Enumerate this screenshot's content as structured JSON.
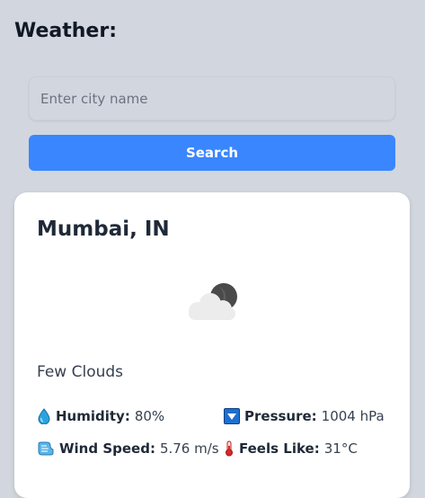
{
  "header": {
    "title": "Weather:"
  },
  "search": {
    "placeholder": "Enter city name",
    "value": "",
    "button_label": "Search"
  },
  "weather": {
    "city": "Mumbai, IN",
    "icon": "few-clouds-night-icon",
    "description": "Few Clouds",
    "details": {
      "humidity": {
        "label": "Humidity:",
        "value": "80%",
        "icon": "water-drop-icon"
      },
      "pressure": {
        "label": "Pressure:",
        "value": "1004 hPa",
        "icon": "down-arrow-box-icon"
      },
      "wind_speed": {
        "label": "Wind Speed:",
        "value": "5.76 m/s",
        "icon": "wind-icon"
      },
      "feels_like": {
        "label": "Feels Like:",
        "value": "31°C",
        "icon": "thermometer-icon"
      }
    }
  },
  "colors": {
    "background": "#d2d6de",
    "accent": "#3a86ff",
    "card": "#ffffff"
  }
}
